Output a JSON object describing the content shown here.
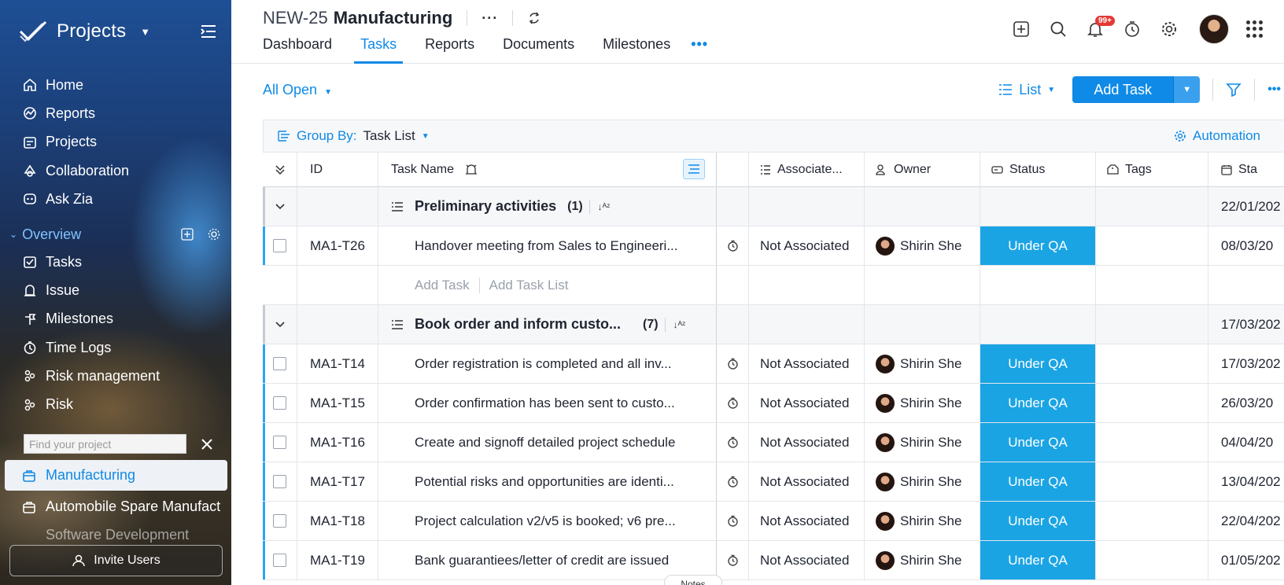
{
  "sidebar": {
    "title": "Projects",
    "nav": [
      {
        "label": "Home",
        "icon": "home-icon"
      },
      {
        "label": "Reports",
        "icon": "reports-icon"
      },
      {
        "label": "Projects",
        "icon": "projects-icon"
      },
      {
        "label": "Collaboration",
        "icon": "collaboration-icon"
      },
      {
        "label": "Ask Zia",
        "icon": "zia-icon"
      }
    ],
    "overview_label": "Overview",
    "overview_items": [
      {
        "label": "Tasks",
        "icon": "tasks-icon"
      },
      {
        "label": "Issue",
        "icon": "issue-icon"
      },
      {
        "label": "Milestones",
        "icon": "milestones-icon"
      },
      {
        "label": "Time Logs",
        "icon": "timelogs-icon"
      },
      {
        "label": "Risk management",
        "icon": "risk-management-icon"
      },
      {
        "label": "Risk",
        "icon": "risk-icon"
      }
    ],
    "search_placeholder": "Find your project",
    "projects": [
      {
        "label": "Manufacturing",
        "active": true
      },
      {
        "label": "Automobile Spare Manufact",
        "active": false
      },
      {
        "label": "Software Development",
        "active": false
      }
    ],
    "invite_label": "Invite Users"
  },
  "header": {
    "project_code": "NEW-25",
    "project_name": "Manufacturing",
    "more": "···",
    "tabs": [
      {
        "label": "Dashboard",
        "active": false
      },
      {
        "label": "Tasks",
        "active": true
      },
      {
        "label": "Reports",
        "active": false
      },
      {
        "label": "Documents",
        "active": false
      },
      {
        "label": "Milestones",
        "active": false
      }
    ],
    "tabs_more": "•••",
    "notification_badge": "99+"
  },
  "toolbar": {
    "filter_label": "All Open",
    "view_label": "List",
    "add_task_label": "Add Task",
    "more": "•••"
  },
  "group_bar": {
    "group_by_key": "Group By:",
    "group_by_value": "Task List",
    "automation_label": "Automation"
  },
  "table": {
    "headers": {
      "id": "ID",
      "task_name": "Task Name",
      "associated": "Associate...",
      "owner": "Owner",
      "status": "Status",
      "tags": "Tags",
      "start": "Sta"
    },
    "groups": [
      {
        "name": "Preliminary activities",
        "count": "(1)",
        "date": "22/01/202",
        "tasks": [
          {
            "id": "MA1-T26",
            "name": "Handover meeting from Sales to Engineeri...",
            "assoc": "Not Associated",
            "owner": "Shirin She",
            "status": "Under QA",
            "date": "08/03/20"
          }
        ],
        "add_task": "Add Task",
        "add_task_list": "Add Task List"
      },
      {
        "name": "Book order and inform custo...",
        "count": "(7)",
        "date": "17/03/202",
        "tasks": [
          {
            "id": "MA1-T14",
            "name": "Order registration is completed and all inv...",
            "assoc": "Not Associated",
            "owner": "Shirin She",
            "status": "Under QA",
            "date": "17/03/202"
          },
          {
            "id": "MA1-T15",
            "name": "Order confirmation has been sent to custo...",
            "assoc": "Not Associated",
            "owner": "Shirin She",
            "status": "Under QA",
            "date": "26/03/20"
          },
          {
            "id": "MA1-T16",
            "name": "Create and signoff detailed project schedule",
            "assoc": "Not Associated",
            "owner": "Shirin She",
            "status": "Under QA",
            "date": "04/04/20"
          },
          {
            "id": "MA1-T17",
            "name": "Potential risks and opportunities are identi...",
            "assoc": "Not Associated",
            "owner": "Shirin She",
            "status": "Under QA",
            "date": "13/04/202"
          },
          {
            "id": "MA1-T18",
            "name": "Project calculation v2/v5 is booked; v6 pre...",
            "assoc": "Not Associated",
            "owner": "Shirin She",
            "status": "Under QA",
            "date": "22/04/202"
          },
          {
            "id": "MA1-T19",
            "name": "Bank guarantiees/letter of credit are issued",
            "assoc": "Not Associated",
            "owner": "Shirin She",
            "status": "Under QA",
            "date": "01/05/202"
          }
        ]
      }
    ],
    "notes_tab": "Notes"
  },
  "colors": {
    "accent": "#0f8ae6",
    "status_under_qa": "#1aa4e4",
    "badge": "#e53935"
  }
}
